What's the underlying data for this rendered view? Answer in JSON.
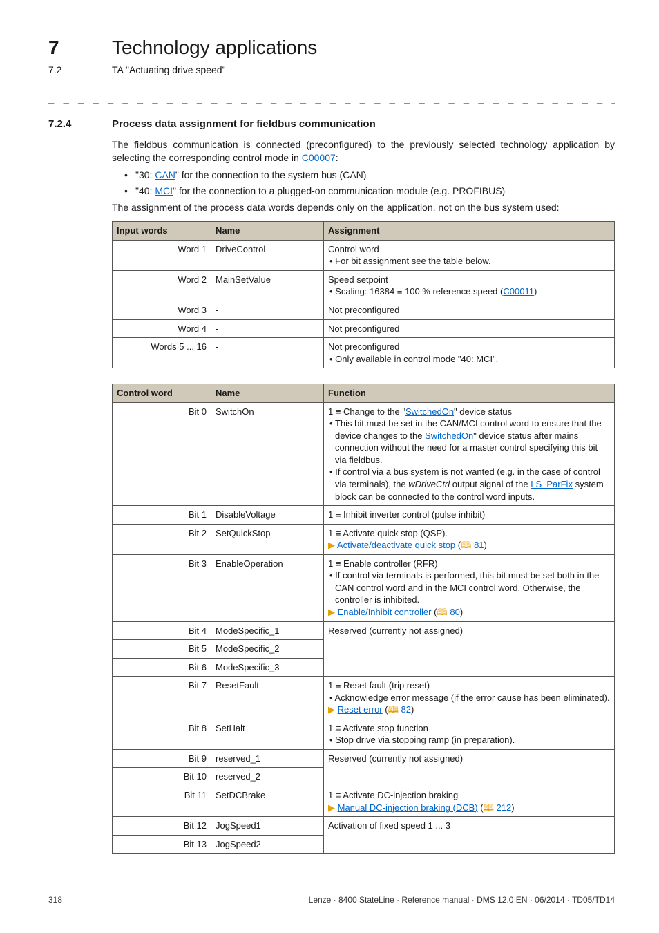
{
  "header": {
    "chapter_num": "7",
    "chapter_title": "Technology applications",
    "sub_num": "7.2",
    "sub_title": "TA \"Actuating drive speed\""
  },
  "dashes": "_ _ _ _ _ _ _ _ _ _ _ _ _ _ _ _ _ _ _ _ _ _ _ _ _ _ _ _ _ _ _ _ _ _ _ _ _ _ _ _ _ _ _ _ _ _ _ _ _ _ _ _ _ _ _ _ _ _ _ _ _ _ _ _",
  "section": {
    "num": "7.2.4",
    "title": "Process data assignment for fieldbus communication"
  },
  "intro": {
    "p1_a": "The fieldbus communication is connected (preconfigured) to the previously selected technology application by selecting the corresponding control mode in ",
    "p1_link": "C00007",
    "p1_b": ":",
    "bul1_a": "\"30: ",
    "bul1_link": "CAN",
    "bul1_b": "\" for the connection to the system bus (CAN)",
    "bul2_a": "\"40: ",
    "bul2_link": "MCI",
    "bul2_b": "\" for the connection to a plugged-on communication module (e.g. PROFIBUS)",
    "p2": "The assignment of the process data words depends only on the application, not on the bus system used:"
  },
  "table1": {
    "headers": {
      "c1": "Input words",
      "c2": "Name",
      "c3": "Assignment"
    },
    "rows": [
      {
        "key": "Word 1",
        "name": "DriveControl",
        "assign_lines": [
          {
            "text": "Control word"
          },
          {
            "bullet": true,
            "text": "For bit assignment see the table below."
          }
        ]
      },
      {
        "key": "Word 2",
        "name": "MainSetValue",
        "assign_lines": [
          {
            "text": "Speed setpoint"
          },
          {
            "bullet": true,
            "pre": "Scaling: 16384 ≡ 100 % reference speed (",
            "link": "C00011",
            "post": ")"
          }
        ]
      },
      {
        "key": "Word 3",
        "name": "-",
        "assign_lines": [
          {
            "text": "Not preconfigured"
          }
        ]
      },
      {
        "key": "Word 4",
        "name": "-",
        "assign_lines": [
          {
            "text": "Not preconfigured"
          }
        ]
      },
      {
        "key": "Words 5 ... 16",
        "name": "-",
        "assign_lines": [
          {
            "text": "Not preconfigured"
          },
          {
            "bullet": true,
            "text": "Only available in control mode \"40: MCI\"."
          }
        ]
      }
    ]
  },
  "table2": {
    "headers": {
      "c1": "Control word",
      "c2": "Name",
      "c3": "Function"
    },
    "rows": [
      {
        "key": "Bit 0",
        "name": "SwitchOn",
        "func": {
          "lead_a": "1 ≡ Change to the \"",
          "lead_link": "SwitchedOn",
          "lead_b": "\" device status",
          "bullets": [
            {
              "pre": "This bit must be set in the CAN/MCI control word to ensure that the device changes to the ",
              "link": "SwitchedOn",
              "post": "\" device status after mains connection without the need for a master control specifying this bit via fieldbus.",
              "wrapLinkQuote": true
            },
            {
              "pre": "If control via a bus system is not wanted (e.g. in the case of control via terminals), the ",
              "italic": "wDriveCtrl",
              "mid": " output signal of the ",
              "link2": "LS_ParFix",
              "post2": " system block can be connected to the control word inputs."
            }
          ]
        }
      },
      {
        "key": "Bit 1",
        "name": "DisableVoltage",
        "func": {
          "lead": "1 ≡ Inhibit inverter control (pulse inhibit)"
        }
      },
      {
        "key": "Bit 2",
        "name": "SetQuickStop",
        "func": {
          "lead": "1 ≡ Activate quick stop (QSP).",
          "booklink": "Activate/deactivate quick stop",
          "pageref": "81"
        }
      },
      {
        "key": "Bit 3",
        "name": "EnableOperation",
        "func": {
          "lead": "1 ≡ Enable controller (RFR)",
          "bullets_simple": [
            "If control via terminals is performed, this bit must be set both in the CAN control word and in the MCI control word. Otherwise, the controller is inhibited."
          ],
          "booklink": "Enable/Inhibit controller",
          "pageref": "80"
        }
      },
      {
        "key": "Bit 4",
        "name": "ModeSpecific_1",
        "func": {
          "lead": "Reserved (currently not assigned)"
        },
        "rowspan": 3
      },
      {
        "key": "Bit 5",
        "name": "ModeSpecific_2",
        "merged": true
      },
      {
        "key": "Bit 6",
        "name": "ModeSpecific_3",
        "merged": true
      },
      {
        "key": "Bit 7",
        "name": "ResetFault",
        "func": {
          "lead": "1 ≡ Reset fault (trip reset)",
          "bullets_simple": [
            "Acknowledge error message (if the error cause has been eliminated)."
          ],
          "booklink": "Reset error",
          "pageref": "82"
        }
      },
      {
        "key": "Bit 8",
        "name": "SetHalt",
        "func": {
          "lead": "1 ≡ Activate stop function",
          "bullets_simple": [
            "Stop drive via stopping ramp (in preparation)."
          ]
        }
      },
      {
        "key": "Bit 9",
        "name": "reserved_1",
        "func": {
          "lead": "Reserved (currently not assigned)"
        },
        "rowspan": 2
      },
      {
        "key": "Bit 10",
        "name": "reserved_2",
        "merged": true
      },
      {
        "key": "Bit 11",
        "name": "SetDCBrake",
        "func": {
          "lead": "1 ≡ Activate DC-injection braking",
          "booklink": "Manual DC-injection braking (DCB)",
          "pageref": "212"
        }
      },
      {
        "key": "Bit 12",
        "name": "JogSpeed1",
        "func": {
          "lead": "Activation of fixed speed 1 ... 3"
        },
        "rowspan": 2
      },
      {
        "key": "Bit 13",
        "name": "JogSpeed2",
        "merged": true
      }
    ]
  },
  "footer": {
    "page": "318",
    "info": "Lenze · 8400 StateLine · Reference manual · DMS 12.0 EN · 06/2014 · TD05/TD14"
  }
}
